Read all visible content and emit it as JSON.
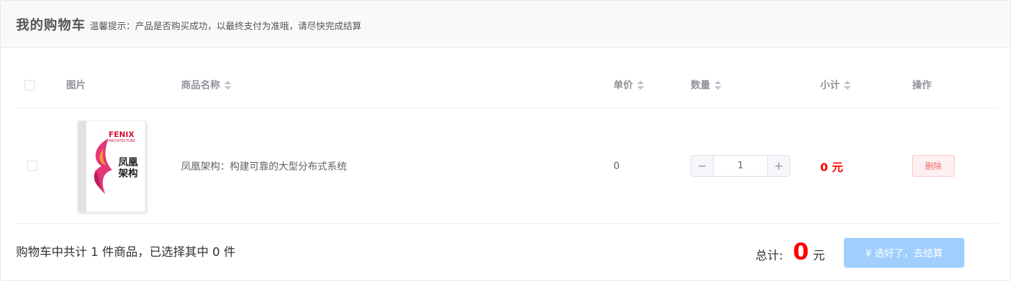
{
  "header": {
    "title": "我的购物车",
    "hint": "温馨提示：产品是否购买成功，以最终支付为准哦，请尽快完成结算"
  },
  "table": {
    "columns": {
      "image": "图片",
      "name": "商品名称",
      "price": "单价",
      "quantity": "数量",
      "subtotal": "小计",
      "actions": "操作"
    },
    "rows": [
      {
        "book_cover": {
          "brand": "FENIX",
          "brand_sub": "ARCHITECTURE",
          "title_line1": "凤凰",
          "title_line2": "架构"
        },
        "name": "凤凰架构：构建可靠的大型分布式系统",
        "price": "0",
        "quantity": "1",
        "subtotal": "0 元",
        "delete_label": "删除"
      }
    ]
  },
  "footer": {
    "summary": "购物车中共计 1 件商品，已选择其中 0 件",
    "total_label": "总计:",
    "total_amount": "0",
    "total_unit": "元",
    "checkout_label": "¥ 选好了，去结算"
  },
  "colors": {
    "price_red": "#ff0000",
    "checkout_disabled": "#a0cfff",
    "danger_text": "#f56c6c"
  }
}
